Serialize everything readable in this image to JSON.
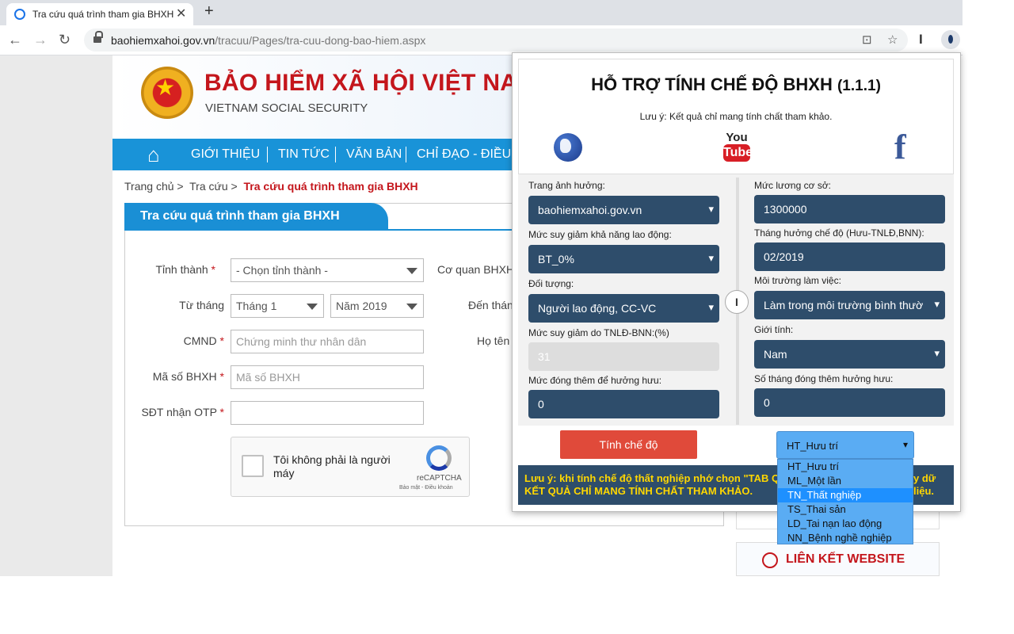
{
  "browser": {
    "tab_title": "Tra cứu quá trình tham gia BHXH",
    "close": "✕",
    "new_tab": "+",
    "url_host": "baohiemxahoi.gov.vn",
    "url_path": "/tracuu/Pages/tra-cuu-dong-bao-hiem.aspx",
    "back": "←",
    "forward": "→",
    "reload": "↻",
    "translate_icon": "⊡",
    "star_icon": "☆",
    "ext_icon": "I"
  },
  "site": {
    "title": "BẢO HIỂM XÃ HỘI VIỆT NAM",
    "subtitle": "VIETNAM SOCIAL SECURITY",
    "home_icon": "⌂",
    "menu": [
      "GIỚI THIỆU",
      "TIN TỨC",
      "VĂN BẢN",
      "CHỈ ĐẠO - ĐIỀU H"
    ],
    "breadcrumb": [
      "Trang chủ >",
      "Tra cứu >"
    ],
    "breadcrumb_current": "Tra cứu quá trình tham gia BHXH",
    "panel_title": "Tra cứu quá trình tham gia BHXH",
    "form": {
      "province_label": "Tỉnh thành",
      "province_value": "- Chọn tỉnh thành -",
      "agency_label": "Cơ quan BHXH",
      "from_label": "Từ tháng",
      "from_month": "Tháng 1",
      "from_year": "Năm 2019",
      "to_label": "Đến thán",
      "id_label": "CMND",
      "id_placeholder": "Chứng minh thư nhân dân",
      "name_label": "Họ tên",
      "bhxh_label": "Mã số BHXH",
      "bhxh_placeholder": "Mã số BHXH",
      "phone_label": "SĐT nhận OTP",
      "required": "*"
    },
    "captcha": {
      "text": "Tôi không phải là người máy",
      "brand": "reCAPTCHA",
      "privacy": "Bảo mật - Điều khoản"
    },
    "links_title": "LIÊN KẾT WEBSITE"
  },
  "popup": {
    "title": "HỖ TRỢ TÍNH CHẾ ĐỘ BHXH",
    "version": "(1.1.1)",
    "note": "Lưu ý: Kết quả chỉ mang tính chất tham khảo.",
    "youtube_top": "You",
    "youtube_bottom": "Tube",
    "facebook": "f",
    "swap_icon": "I",
    "left": [
      {
        "label": "Trang ảnh hưởng:",
        "value": "baohiemxahoi.gov.vn"
      },
      {
        "label": "Mức suy giảm khả năng lao động:",
        "value": "BT_0%"
      },
      {
        "label": "Đối tượng:",
        "value": "Người lao động, CC-VC"
      },
      {
        "label": "Mức suy giảm do TNLĐ-BNN:(%)",
        "value": "31"
      },
      {
        "label": "Mức đóng thêm để hưởng hưu:",
        "value": "0"
      }
    ],
    "right": [
      {
        "label": "Mức lương cơ sở:",
        "value": "1300000"
      },
      {
        "label": "Tháng hưởng chế độ (Hưu-TNLĐ,BNN):",
        "value": "02/2019"
      },
      {
        "label": "Môi trường làm việc:",
        "value": "Làm trong môi trường bình thườ"
      },
      {
        "label": "Giới tính:",
        "value": "Nam"
      },
      {
        "label": "Số tháng đóng thêm hưởng hưu:",
        "value": "0"
      }
    ],
    "calc_button": "Tính chế độ",
    "mode_selected": "HT_Hưu trí",
    "mode_options": [
      "HT_Hưu trí",
      "ML_Một lần",
      "TN_Thất nghiệp",
      "TS_Thai sản",
      "LD_Tai nạn lao động",
      "NN_Bệnh nghề nghiệp"
    ],
    "bottom_note_1": "Lưu ý: khi tính chế độ thất nghiệp nhớ chọn \"TAB QUÁ",
    "bottom_note_1b": "y dữ liệu.",
    "bottom_note_2": "KẾT QUẢ CHỈ MANG TÍNH CHẤT THAM KHẢO."
  }
}
